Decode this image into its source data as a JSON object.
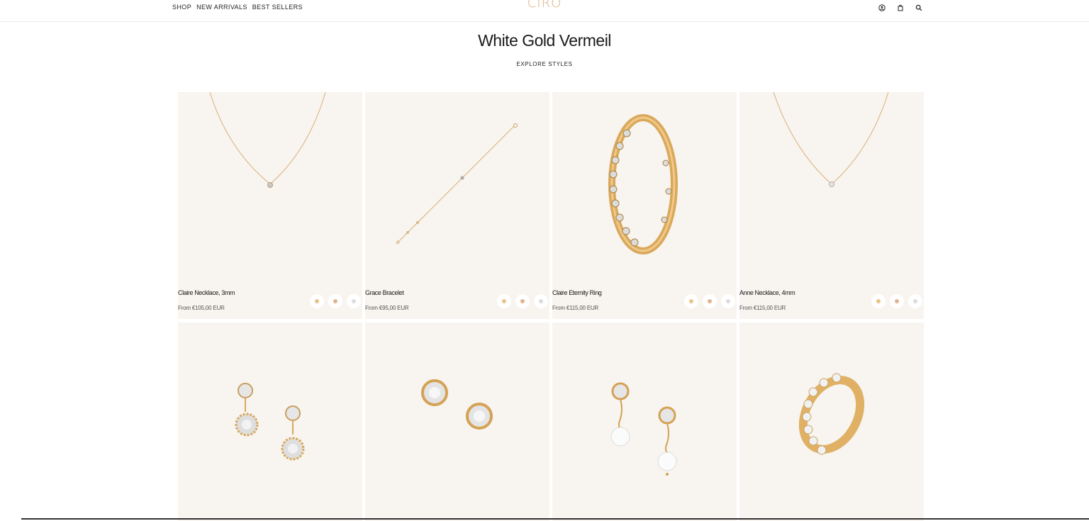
{
  "header": {
    "nav": [
      "SHOP",
      "NEW ARRIVALS",
      "BEST SELLERS"
    ],
    "logo": "CIRO",
    "icons": [
      "account-icon",
      "bag-icon",
      "search-icon"
    ]
  },
  "page": {
    "title": "White Gold Vermeil",
    "explore_label": "EXPLORE STYLES"
  },
  "colors": {
    "card_bg": "#f8f4ef",
    "gold": "#d9b07a",
    "swatch_yellow": "#e8c48a",
    "swatch_rose": "#e3b38f",
    "swatch_white": "#dcdcdc"
  },
  "products": [
    {
      "name": "Claire Necklace, 3mm",
      "price": "From €105,00 EUR",
      "image": "necklace-icon"
    },
    {
      "name": "Grace Bracelet",
      "price": "From €95,00 EUR",
      "image": "bracelet-icon"
    },
    {
      "name": "Claire Eternity Ring",
      "price": "From €115,00 EUR",
      "image": "eternity-ring-icon"
    },
    {
      "name": "Anne Necklace, 4mm",
      "price": "From €115,00 EUR",
      "image": "necklace-icon"
    },
    {
      "name": "",
      "price": "",
      "image": "halo-drop-earrings-icon"
    },
    {
      "name": "",
      "price": "",
      "image": "stud-earrings-icon"
    },
    {
      "name": "",
      "price": "",
      "image": "pearl-drop-earrings-icon"
    },
    {
      "name": "",
      "price": "",
      "image": "stone-ring-icon"
    }
  ]
}
